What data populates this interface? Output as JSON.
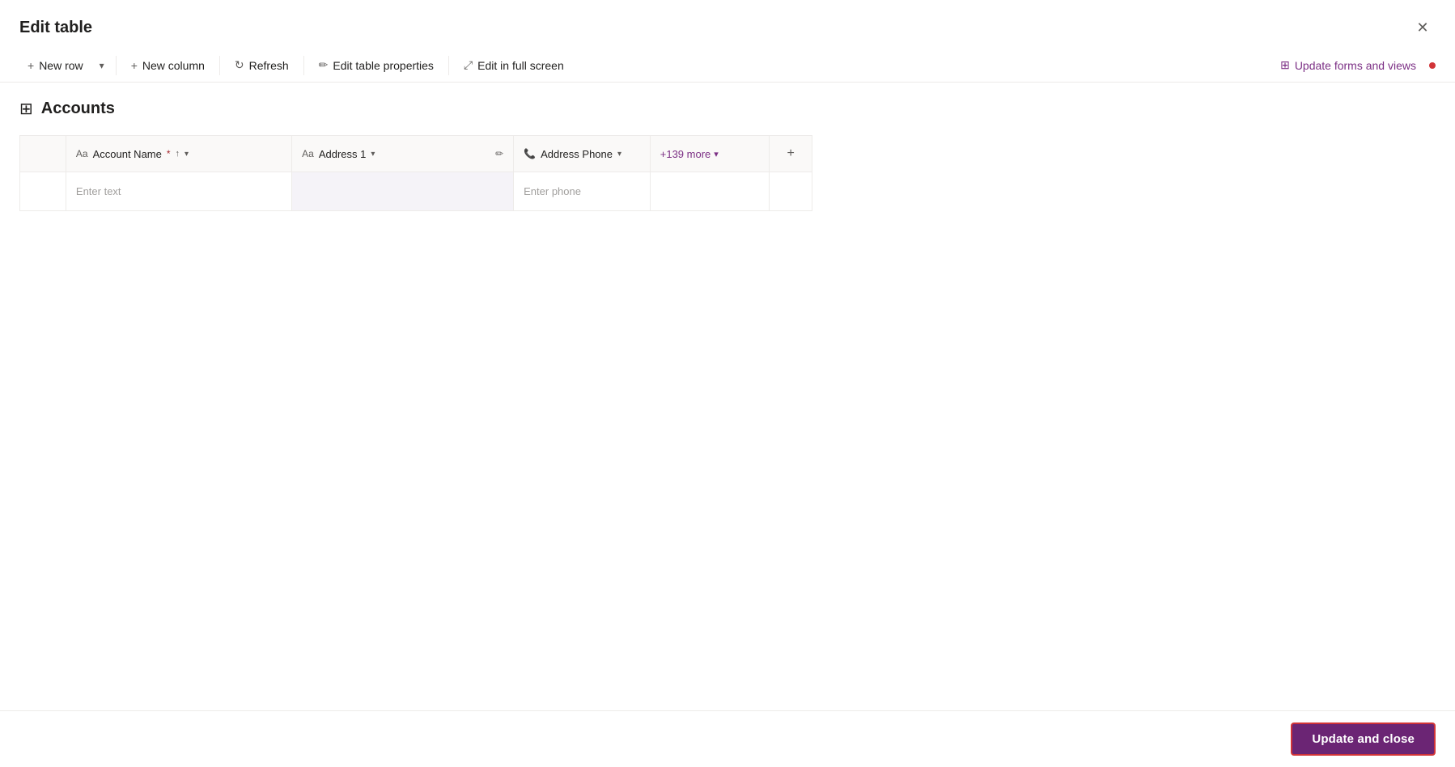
{
  "title": "Edit table",
  "close_label": "✕",
  "toolbar": {
    "new_row_label": "New row",
    "new_row_dropdown_icon": "▾",
    "new_column_label": "New column",
    "refresh_label": "Refresh",
    "edit_table_props_label": "Edit table properties",
    "edit_fullscreen_label": "Edit in full screen",
    "update_forms_label": "Update forms and views",
    "update_forms_icon": "⊞"
  },
  "table": {
    "name": "Accounts",
    "grid_icon": "⊞",
    "columns": [
      {
        "id": "row_num",
        "type": "row_num",
        "label": ""
      },
      {
        "id": "account_name",
        "type": "text",
        "icon": "Aa",
        "label": "Account Name",
        "required": true,
        "sort": "↑",
        "has_dropdown": true,
        "placeholder": "Enter text"
      },
      {
        "id": "address1",
        "type": "text",
        "icon": "Aa",
        "label": "Address 1",
        "required": false,
        "has_dropdown": true,
        "has_edit": true,
        "selected": true,
        "placeholder": ""
      },
      {
        "id": "address_phone",
        "type": "phone",
        "icon": "📞",
        "label": "Address Phone",
        "required": false,
        "has_dropdown": true,
        "placeholder": "Enter phone"
      }
    ],
    "more_label": "+139 more",
    "add_column_icon": "+",
    "rows": [
      {
        "id": 1,
        "account_name": "",
        "address1": "",
        "address_phone": ""
      }
    ]
  },
  "footer": {
    "update_close_label": "Update and close"
  }
}
